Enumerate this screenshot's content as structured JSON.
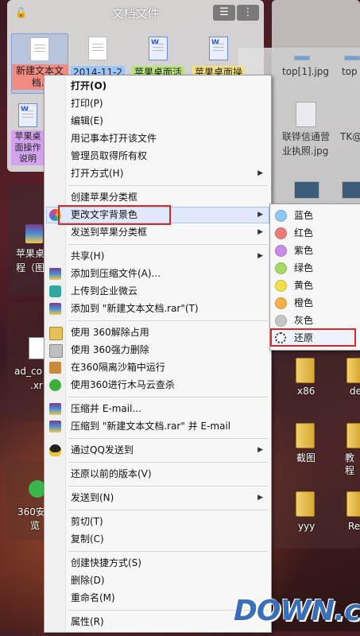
{
  "fence": {
    "title": "文档文件",
    "icons": [
      {
        "label": "新建文本文档.t",
        "color": "red"
      },
      {
        "label": "2014-11-2",
        "color": "blue"
      },
      {
        "label": "苹果桌面活",
        "color": "green"
      },
      {
        "label": "苹果桌面操",
        "color": "yellow"
      },
      {
        "label": "苹果桌面操作说明",
        "color": "purple"
      }
    ]
  },
  "desktop_left": [
    {
      "label": "苹果桌"
    },
    {
      "label": "程（图"
    },
    {
      "label": "ad_co"
    },
    {
      "label": ".xr"
    },
    {
      "label": "360安"
    },
    {
      "label": "览"
    }
  ],
  "desktop_right": [
    {
      "label": "top[1].jpg"
    },
    {
      "label": "top"
    },
    {
      "label": "联铧信通营"
    },
    {
      "label": "业执照.jpg"
    },
    {
      "label": "TK@"
    },
    {
      "label": "x86"
    },
    {
      "label": "de"
    },
    {
      "label": "截图"
    },
    {
      "label": "教程"
    },
    {
      "label": "yyy"
    },
    {
      "label": "Re"
    }
  ],
  "context_menu": {
    "items": [
      {
        "label": "打开(O)",
        "bold": true
      },
      {
        "label": "打印(P)"
      },
      {
        "label": "编辑(E)"
      },
      {
        "label": "用记事本打开该文件"
      },
      {
        "label": "管理员取得所有权"
      },
      {
        "label": "打开方式(H)",
        "submenu": true
      },
      {
        "label": "创建苹果分类框"
      },
      {
        "label": "更改文字背景色",
        "submenu": true,
        "highlighted": true
      },
      {
        "label": "发送到苹果分类框",
        "submenu": true
      },
      {
        "label": "共享(H)",
        "submenu": true
      },
      {
        "label": "添加到压缩文件(A)..."
      },
      {
        "label": "上传到企业微云"
      },
      {
        "label": "添加到 \"新建文本文档.rar\"(T)"
      },
      {
        "label": "使用 360解除占用"
      },
      {
        "label": "使用 360强力删除"
      },
      {
        "label": "在360隔离沙箱中运行"
      },
      {
        "label": "使用360进行木马云查杀"
      },
      {
        "label": "压缩并 E-mail..."
      },
      {
        "label": "压缩到 \"新建文本文档.rar\" 并 E-mail"
      },
      {
        "label": "通过QQ发送到",
        "submenu": true
      },
      {
        "label": "还原以前的版本(V)"
      },
      {
        "label": "发送到(N)",
        "submenu": true
      },
      {
        "label": "剪切(T)"
      },
      {
        "label": "复制(C)"
      },
      {
        "label": "创建快捷方式(S)"
      },
      {
        "label": "删除(D)"
      },
      {
        "label": "重命名(M)"
      },
      {
        "label": "属性(R)"
      }
    ]
  },
  "color_submenu": {
    "items": [
      {
        "label": "蓝色",
        "color": "#8ec8f2"
      },
      {
        "label": "红色",
        "color": "#ef7a7a"
      },
      {
        "label": "紫色",
        "color": "#c98be8"
      },
      {
        "label": "绿色",
        "color": "#a6d86a"
      },
      {
        "label": "黄色",
        "color": "#f4de4a"
      },
      {
        "label": "橙色",
        "color": "#f6b04a"
      },
      {
        "label": "灰色",
        "color": "#c6c6c6"
      },
      {
        "label": "还原",
        "color": "",
        "highlighted": true
      }
    ]
  },
  "watermark": {
    "text": "DOWN.cc"
  }
}
